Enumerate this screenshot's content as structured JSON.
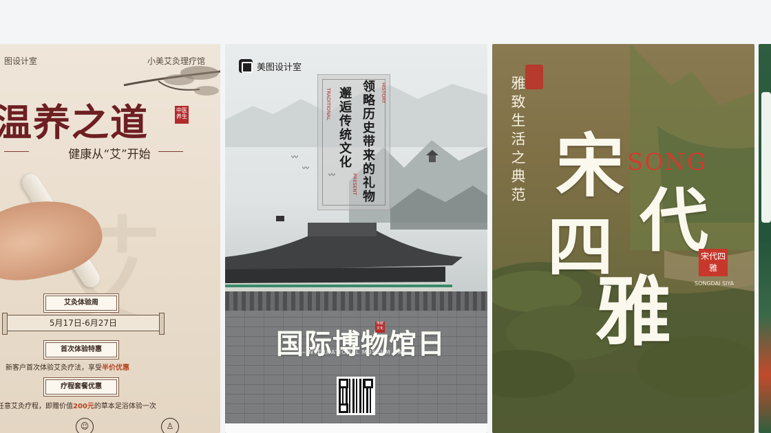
{
  "carousel": {
    "card1": {
      "brand_left": "图设计室",
      "brand_right": "小美艾灸理疗馆",
      "title": "温养之道",
      "seal": "中医养生",
      "subtitle": "健康从“艾”开始",
      "tag1": "艾灸体验周",
      "date": "5月17日-6月27日",
      "tag2": "首次体验特惠",
      "line1_pre": "新客户首次体验艾灸疗法，享受",
      "line1_hl": "半价优惠",
      "tag3": "疗程套餐优惠",
      "line2_pre": "任意艾灸疗程，即赠价值",
      "line2_hl": "200元",
      "line2_post": "的草本足浴体验一次"
    },
    "card2": {
      "brand": "美图设计室",
      "vertical_left": "邂逅传统文化",
      "vertical_right": "领略历史带来的礼物",
      "red_traditional": "TRADITIONAL",
      "red_history": "HISTORY",
      "red_present": "PRESENT",
      "title": "国际博物馆日",
      "title_seal": "传统文化",
      "subtitle": "—INTERNATIONAL MUSEUM DAY—"
    },
    "card3": {
      "poem": "雅致生活之典范",
      "big1": "宋",
      "big2": "代",
      "big3": "四",
      "big4": "雅",
      "song": "SONG",
      "stamp": "宋代四雅",
      "stamp_sub": "SONGDAI SIYA"
    }
  }
}
